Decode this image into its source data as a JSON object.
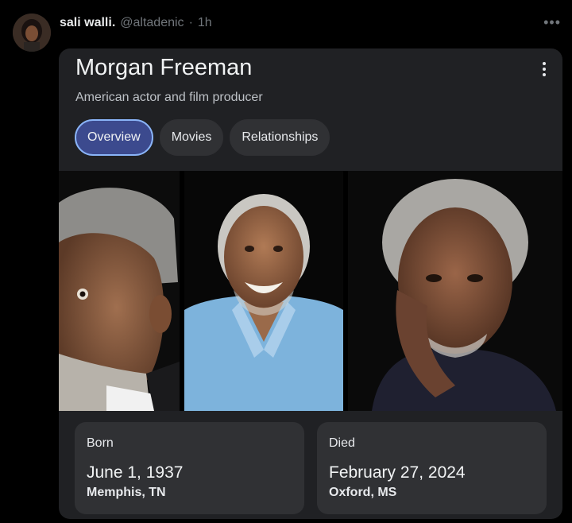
{
  "tweet": {
    "author_name": "sali walli.",
    "handle": "@altadenic",
    "separator": "·",
    "time": "1h",
    "more_icon": "more-horizontal-icon"
  },
  "card": {
    "title": "Morgan Freeman",
    "subtitle": "American actor and film producer",
    "menu_icon": "more-vertical-icon",
    "tabs": [
      {
        "label": "Overview",
        "active": true
      },
      {
        "label": "Movies",
        "active": false
      },
      {
        "label": "Relationships",
        "active": false
      }
    ],
    "born": {
      "label": "Born",
      "date": "June 1, 1937",
      "place": "Memphis, TN"
    },
    "died": {
      "label": "Died",
      "date": "February 27, 2024",
      "place": "Oxford, MS"
    }
  },
  "colors": {
    "background": "#000000",
    "card": "#202124",
    "chip": "#303134",
    "active_chip": "#3c4a8e",
    "active_border": "#8ab4f8"
  }
}
